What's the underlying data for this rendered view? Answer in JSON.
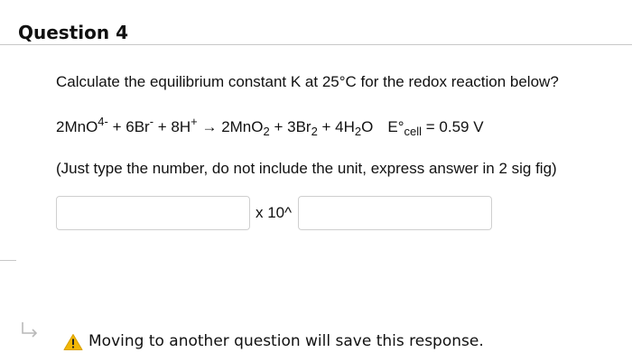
{
  "question": {
    "title": "Question 4",
    "prompt": "Calculate the equilibrium constant K at 25°C for the redox reaction below?",
    "equation": {
      "mno4": "2MnO",
      "mno4_sup": "4-",
      "br": " + 6Br",
      "br_sup": "-",
      "h": " + 8H",
      "h_sup": "+",
      "arrow": " → 2MnO",
      "mno2_sub": "2",
      "br2": " + 3Br",
      "br2_sub": "2",
      "h2o_pre": " + 4H",
      "h2o_sub": "2",
      "h2o_post": "O",
      "ecell": "E°",
      "ecell_sub": "cell",
      "ecell_value": " = 0.59 V"
    },
    "instructions": "(Just type the number, do not include the unit, express answer in 2 sig fig)",
    "answer": {
      "coefficient_value": "",
      "times_ten": "x 10^",
      "exponent_value": ""
    }
  },
  "footer": {
    "save_note": "Moving to another question will save this response."
  },
  "colors": {
    "warning": "#f2b705",
    "rule": "#c8c8c8"
  }
}
